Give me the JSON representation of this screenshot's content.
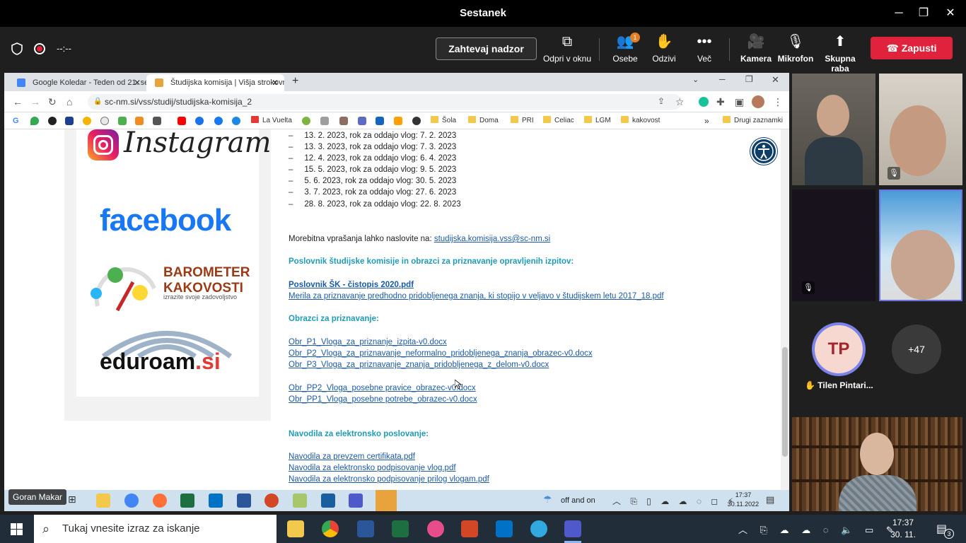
{
  "meeting": {
    "title": "Sestanek",
    "timer": "--:--",
    "request_control": "Zahtevaj nadzor",
    "buttons": [
      {
        "label": "Odpri v oknu",
        "icon": "popout-icon"
      },
      {
        "label": "Osebe",
        "icon": "people-icon",
        "badge": "1"
      },
      {
        "label": "Odzivi",
        "icon": "reactions-icon"
      },
      {
        "label": "Več",
        "icon": "more-icon"
      },
      {
        "label": "Kamera",
        "icon": "camera-icon"
      },
      {
        "label": "Mikrofon",
        "icon": "mic-muted-icon"
      },
      {
        "label": "Skupna raba",
        "icon": "share-icon"
      }
    ],
    "leave": "Zapusti",
    "presenter": "Goran Makar",
    "attendee_initials": "TP",
    "attendee_name": "Tilen Pintari...",
    "more_count": "+47"
  },
  "browser": {
    "tabs": [
      {
        "title": "Google Koledar - Teden od 21. se",
        "favicon_color": "#4285f4"
      },
      {
        "title": "Študijska komisija | Višja strokovn",
        "favicon_color": "#e8a33d"
      }
    ],
    "url": "sc-nm.si/vss/studij/studijska-komisija_2",
    "bookmarks": [
      "La Vuelta",
      "Šola",
      "Doma",
      "PRI",
      "Celiac",
      "LGM",
      "kakovost",
      "Drugi zaznamki"
    ]
  },
  "page": {
    "logos": {
      "instagram": "Instagram",
      "facebook": "facebook",
      "barometer_1": "BAROMETER",
      "barometer_2": "KAKOVOSTI",
      "barometer_3": "izrazite svoje zadovoljstvo",
      "eduroam": "eduroam",
      "eduroam_tld": ".si"
    },
    "dates": [
      "13. 2. 2023, rok za oddajo vlog: 7. 2. 2023",
      "13. 3. 2023, rok za oddajo vlog: 7. 3. 2023",
      "12. 4. 2023, rok za oddajo vlog: 6. 4. 2023",
      "15. 5. 2023, rok za oddajo vlog: 9. 5. 2023",
      "5. 6. 2023, rok za oddajo vlog: 30. 5. 2023",
      "3. 7. 2023, rok za oddajo vlog: 27. 6. 2023",
      "28. 8. 2023, rok za oddajo vlog: 22. 8. 2023"
    ],
    "dash": "–",
    "contact_text": "Morebitna vprašanja lahko naslovite na: ",
    "contact_email": "studijska.komisija.vss@sc-nm.si",
    "heading_rules": "Poslovnik študijske komisije in obrazci za priznavanje opravljenih izpitov:",
    "rules_link_1": "Poslovnik ŠK - čistopis 2020.pdf",
    "rules_link_2": "Merila za priznavanje predhodno pridobljenega znanja, ki stopijo v veljavo v študijskem letu 2017_18.pdf",
    "heading_forms": "Obrazci za priznavanje:",
    "forms": [
      "Obr_P1_Vloga_za_priznanje_izpita-v0.docx",
      "Obr_P2_Vloga_za_priznavanje_neformalno_pridobljenega_znanja_obrazec-v0.docx",
      "Obr_P3_Vloga_za_priznavanje_znanja_pridobljenega_z_delom-v0.docx"
    ],
    "forms_special": [
      "Obr_PP2_Vloga_posebne pravice_obrazec-v0.docx",
      "Obr_PP1_Vloga_posebne potrebe_obrazec-v0.docx"
    ],
    "heading_e": "Navodila za elektronsko poslovanje:",
    "e_links": [
      "Navodila za prevzem certifikata.pdf",
      "Navodila za elektronsko podpisovanje vlog.pdf",
      "Navodila za elektronsko podpisovanje prilog vlogam.pdf"
    ]
  },
  "inner_taskbar": {
    "weather": "off and on",
    "time": "17:37",
    "date": "30.11.2022"
  },
  "windows_taskbar": {
    "search_placeholder": "Tukaj vnesite izraz za iskanje",
    "time": "17:37",
    "date": "30. 11. 2022",
    "notifications": "3"
  }
}
